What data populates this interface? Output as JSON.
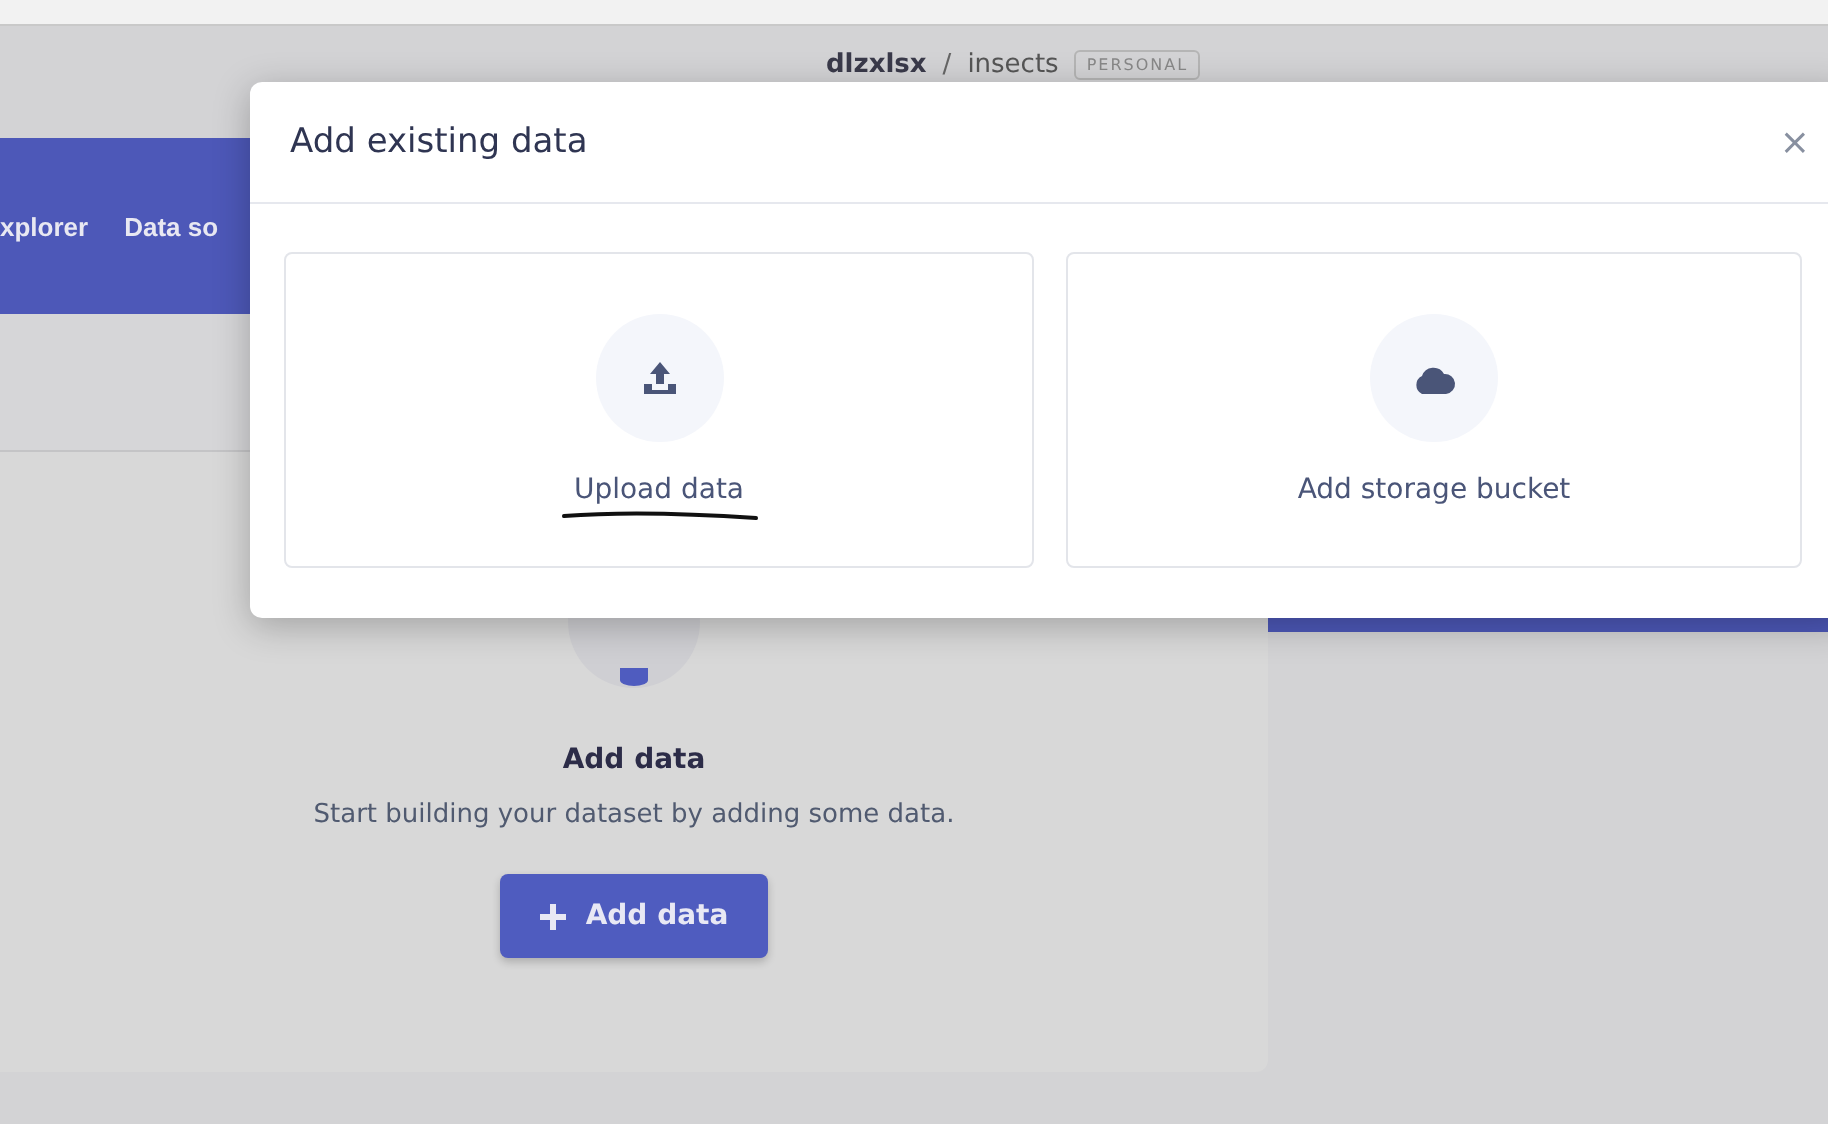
{
  "header": {
    "owner": "dlzxlsx",
    "separator": "/",
    "project": "insects",
    "badge": "PERSONAL"
  },
  "nav": {
    "items": [
      "xplorer",
      "Data so"
    ]
  },
  "empty_state": {
    "title": "Add data",
    "description": "Start building your dataset by adding some data.",
    "button": "Add data"
  },
  "modal": {
    "title": "Add existing data",
    "close": "×",
    "options": [
      {
        "label": "Upload data",
        "kind": "upload",
        "annotated": true
      },
      {
        "label": "Add storage bucket",
        "kind": "bucket",
        "annotated": false
      }
    ]
  }
}
